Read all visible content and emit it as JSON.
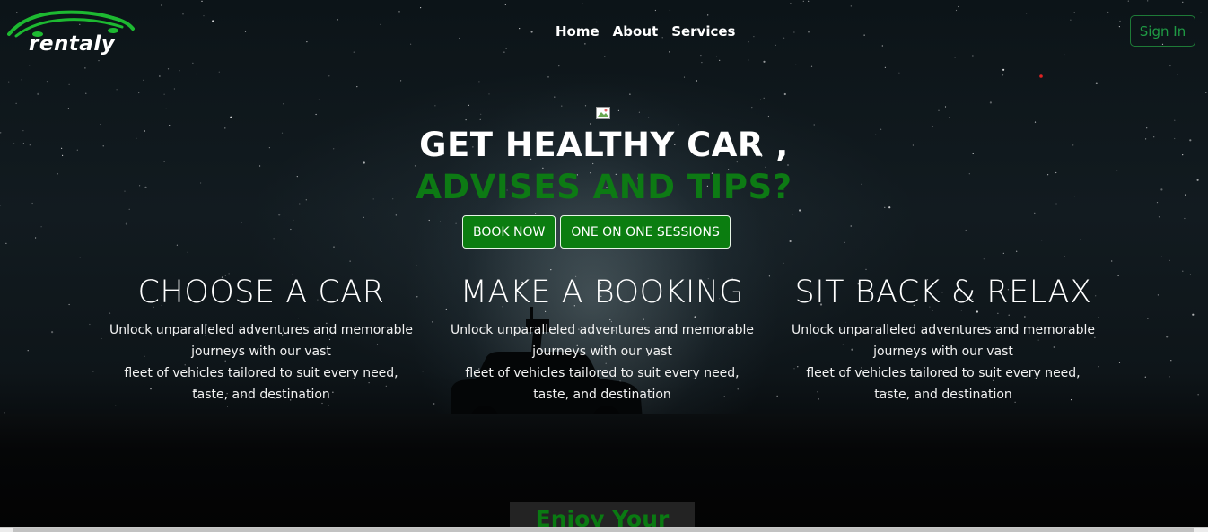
{
  "brand": {
    "name": "rentaly",
    "accent": "#1db931"
  },
  "nav": {
    "items": [
      "Home",
      "About",
      "Services"
    ]
  },
  "header": {
    "signin_label": "Sign In",
    "signin_color": "#1f9a44"
  },
  "hero": {
    "headline_line1": "GET HEALTHY CAR ,",
    "headline_line2": "ADVISES AND TIPS?",
    "headline_accent": "#0d7a14",
    "buttons": [
      "BOOK NOW",
      "ONE ON ONE SESSIONS"
    ],
    "button_color": "#0b7d10"
  },
  "features": [
    {
      "title": "CHOOSE A CAR",
      "lines": [
        "Unlock unparalleled adventures and memorable",
        "journeys with our vast",
        "fleet of vehicles tailored to suit every need,",
        "taste, and destination"
      ]
    },
    {
      "title": "MAKE A BOOKING",
      "lines": [
        "Unlock unparalleled adventures and memorable",
        "journeys with our vast",
        "fleet of vehicles tailored to suit every need,",
        "taste, and destination"
      ]
    },
    {
      "title": "SIT BACK & RELAX",
      "lines": [
        "Unlock unparalleled adventures and memorable",
        "journeys with our vast",
        "fleet of vehicles tailored to suit every need,",
        "taste, and destination"
      ]
    }
  ],
  "section": {
    "heading": "Enjoy Your Ride"
  }
}
